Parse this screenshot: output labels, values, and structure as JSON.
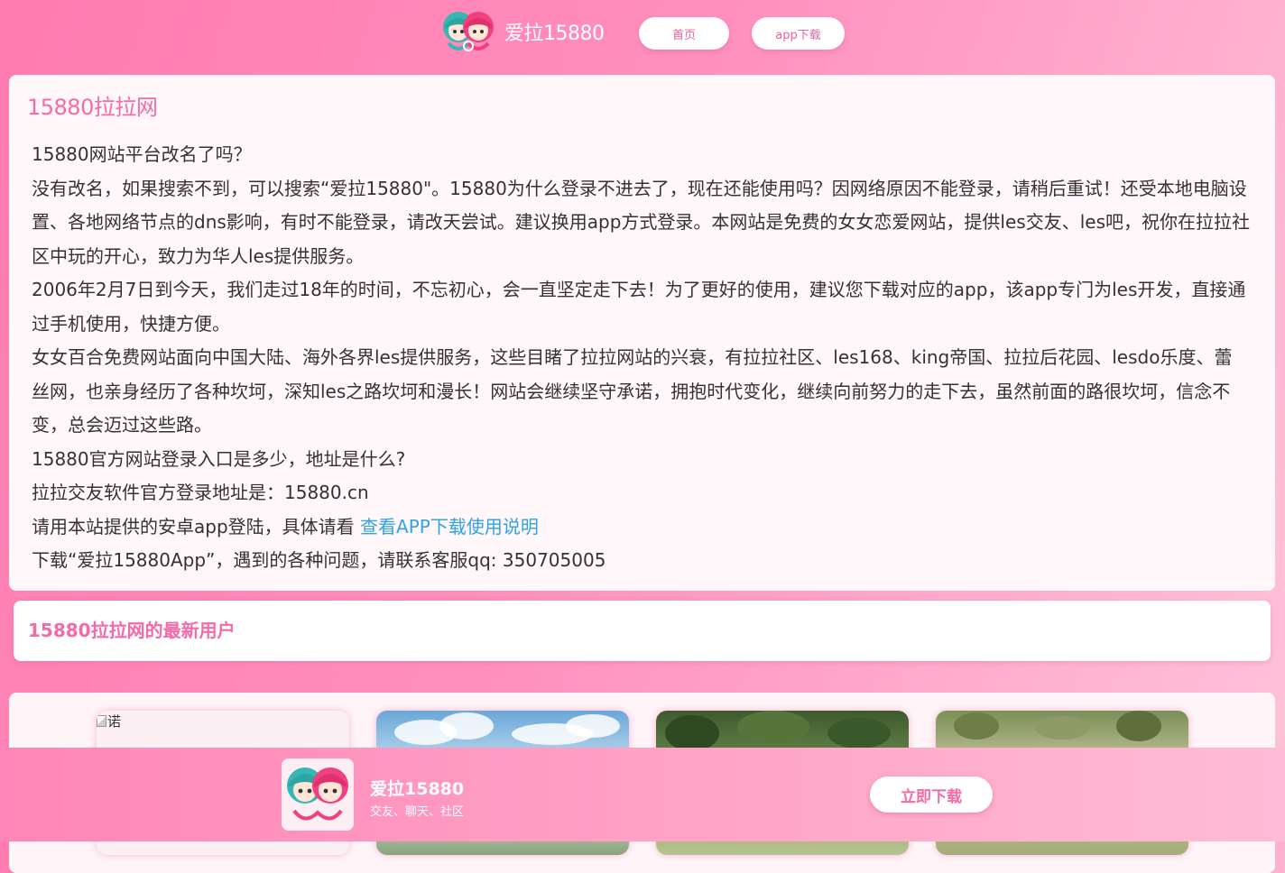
{
  "header": {
    "brand_name": "爱拉15880",
    "nav": {
      "home_label": "首页",
      "app_label": "app下载"
    }
  },
  "intro": {
    "title": "15880拉拉网",
    "paragraphs": [
      "15880网站平台改名了吗？",
      "没有改名，如果搜索不到，可以搜索“爱拉15880\"。15880为什么登录不进去了，现在还能使用吗？因网络原因不能登录，请稍后重试！还受本地电脑设置、各地网络节点的dns影响，有时不能登录，请改天尝试。建议换用app方式登录。本网站是免费的女女恋爱网站，提供les交友、les吧，祝你在拉拉社区中玩的开心，致力为华人les提供服务。",
      "2006年2月7日到今天，我们走过18年的时间，不忘初心，会一直坚定走下去！为了更好的使用，建议您下载对应的app，该app专门为les开发，直接通过手机使用，快捷方便。",
      "女女百合免费网站面向中国大陆、海外各界les提供服务，这些目睹了拉拉网站的兴衰，有拉拉社区、les168、king帝国、拉拉后花园、lesdo乐度、蕾丝网，也亲身经历了各种坎坷，深知les之路坎坷和漫长！网站会继续坚守承诺，拥抱时代变化，继续向前努力的走下去，虽然前面的路很坎坷，信念不变，总会迈过这些路。",
      "15880官方网站登录入口是多少，地址是什么?",
      "拉拉交友软件官方登录地址是：15880.cn"
    ],
    "app_line_prefix": "请用本站提供的安卓app登陆，具体请看 ",
    "app_line_link": "查看APP下载使用说明",
    "contact_line": "下载“爱拉15880App”，遇到的各种问题，请联系客服qq: 350705005"
  },
  "latest_users": {
    "title": "15880拉拉网的最新用户",
    "items": [
      {
        "alt": "诺"
      },
      {
        "alt": ""
      },
      {
        "alt": ""
      },
      {
        "alt": ""
      }
    ]
  },
  "download_banner": {
    "app_name": "爱拉15880",
    "app_subtitle": "交友、聊天、社区",
    "button_label": "立即下载"
  },
  "colors": {
    "accent_pink": "#f56aa7",
    "link_blue": "#2fa3e6",
    "card_bg": "#fff7fa"
  },
  "icons": {
    "logo": "two-girls-logo-icon",
    "broken_image": "broken-image-icon"
  }
}
